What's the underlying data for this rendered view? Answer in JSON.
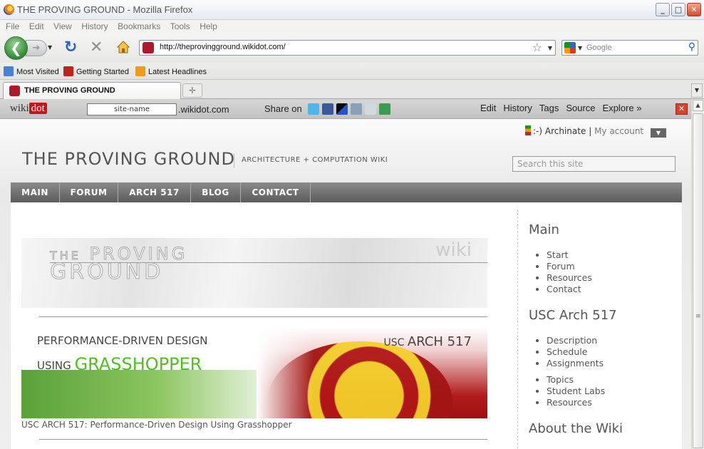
{
  "window": {
    "title": "THE PROVING GROUND - Mozilla Firefox",
    "controls": [
      "_",
      "□",
      "✕"
    ]
  },
  "menubar": [
    "File",
    "Edit",
    "View",
    "History",
    "Bookmarks",
    "Tools",
    "Help"
  ],
  "navbar": {
    "url": "http://theprovingground.wikidot.com/",
    "search_placeholder": "Google"
  },
  "bookmarks": [
    "Most Visited",
    "Getting Started",
    "Latest Headlines"
  ],
  "tabs": [
    {
      "label": "THE PROVING GROUND"
    }
  ],
  "wikidot": {
    "logo_a": "wiki",
    "logo_b": "dot",
    "site_input": "site-name",
    "domain": ".wikidot.com",
    "share_label": "Share on",
    "menu": [
      "Edit",
      "History",
      "Tags",
      "Source",
      "Explore »"
    ]
  },
  "site": {
    "user": "Archinate",
    "separator": "|",
    "my_account": "My account",
    "title": "THE PROVING GROUND",
    "subtitle": "ARCHITECTURE + COMPUTATION WIKI",
    "search_placeholder": "Search this site",
    "nav": [
      "MAIN",
      "FORUM",
      "ARCH 517",
      "BLOG",
      "CONTACT"
    ]
  },
  "banner1": {
    "line1_a": "THE",
    "line1_b": "PROVING",
    "line2": "GROUND",
    "wiki": "wiki"
  },
  "banner2": {
    "line1": "PERFORMANCE-DRIVEN DESIGN",
    "line2_a": "USING",
    "line2_b": "GRASSHOPPER",
    "usc_a": "USC",
    "usc_b": "ARCH 517"
  },
  "caption": "USC ARCH 517: Performance-Driven Design Using Grasshopper",
  "sidebar": {
    "sections": [
      {
        "heading": "Main",
        "items": [
          "Start",
          "Forum",
          "Resources",
          "Contact"
        ]
      },
      {
        "heading": "USC Arch 517",
        "items": [
          "Description",
          "Schedule",
          "Assignments"
        ],
        "items2": [
          "Topics",
          "Student Labs",
          "Resources"
        ]
      },
      {
        "heading": "About the Wiki"
      }
    ]
  }
}
